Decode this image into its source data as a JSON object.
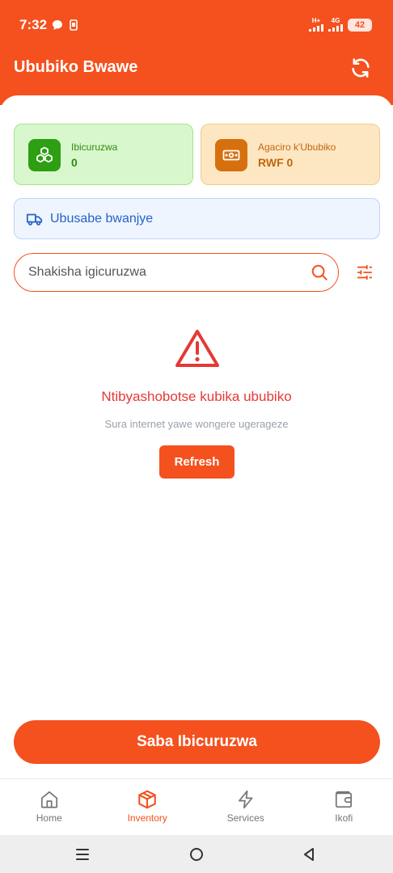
{
  "status_bar": {
    "time": "7:32",
    "network": "H+",
    "network2": "4G",
    "battery": "42"
  },
  "app_bar": {
    "title": "Ububiko Bwawe"
  },
  "stats": {
    "products": {
      "label": "Ibicuruzwa",
      "value": "0"
    },
    "inventory_value": {
      "label": "Agaciro k'Ububiko",
      "value": "RWF 0"
    }
  },
  "orders": {
    "label": "Ubusabe bwanjye"
  },
  "search": {
    "placeholder": "Shakisha igicuruzwa"
  },
  "error": {
    "title": "Ntibyashobotse kubika ububiko",
    "subtitle": "Sura internet yawe wongere ugerageze",
    "action_label": "Refresh"
  },
  "primary_action": {
    "label": "Saba Ibicuruzwa"
  },
  "bottom_nav": {
    "items": [
      {
        "label": "Home",
        "icon": "home-icon"
      },
      {
        "label": "Inventory",
        "icon": "box-icon",
        "active": true
      },
      {
        "label": "Services",
        "icon": "lightning-icon"
      },
      {
        "label": "Ikofi",
        "icon": "wallet-icon"
      }
    ]
  },
  "colors": {
    "primary": "#f4511e",
    "success": "#2e9e13",
    "warning": "#d6700f",
    "info": "#2563c9",
    "error": "#e53935"
  }
}
